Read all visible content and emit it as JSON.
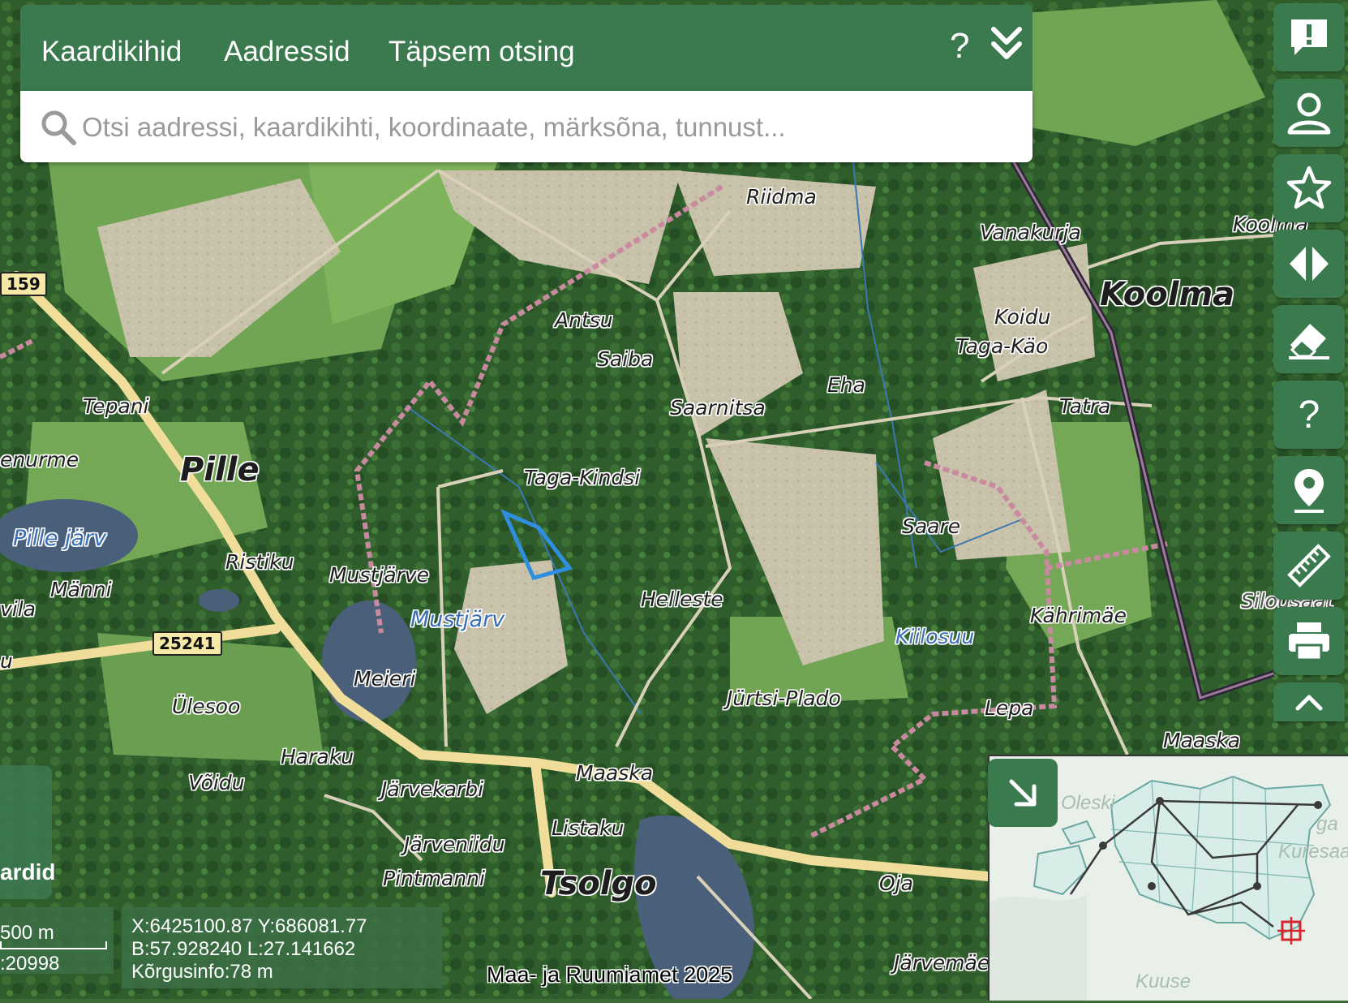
{
  "header": {
    "tabs": [
      {
        "label": "Kaardikihid"
      },
      {
        "label": "Aadressid"
      },
      {
        "label": "Täpsem otsing"
      }
    ],
    "help_label": "?",
    "search_placeholder": "Otsi aadressi, kaardikihti, koordinaate, märksõna, tunnust..."
  },
  "toolbar": {
    "buttons": [
      {
        "icon": "feedback-icon"
      },
      {
        "icon": "user-icon"
      },
      {
        "icon": "star-icon"
      },
      {
        "icon": "compare-icon"
      },
      {
        "icon": "eraser-icon"
      },
      {
        "icon": "help-icon",
        "label": "?"
      },
      {
        "icon": "location-pin-icon"
      },
      {
        "icon": "ruler-icon"
      },
      {
        "icon": "print-icon"
      },
      {
        "icon": "chevron-up-icon"
      }
    ]
  },
  "map": {
    "places": {
      "riidma": "Riidma",
      "vanakurja": "Vanakurja",
      "koolma_small": "Koolma",
      "koolma": "Koolma",
      "koidu": "Koidu",
      "taga_kao": "Taga-Käo",
      "antsu": "Antsu",
      "saiba": "Saiba",
      "eha": "Eha",
      "tatra": "Tatra",
      "saarnitsa": "Saarnitsa",
      "tepani": "Tepani",
      "enurme": "enurme",
      "pille": "Pille",
      "taga_kindsi": "Taga-Kindsi",
      "saare": "Saare",
      "ristiku": "Ristiku",
      "mustjarve": "Mustjärve",
      "manni": "Männi",
      "vila": "vila",
      "helleste": "Helleste",
      "kahrimae": "Kährimäe",
      "silo": "Silousaat",
      "kiilosuu": "Kiilosuu",
      "meieri": "Meieri",
      "ulesoo": "Ülesoo",
      "jurtsi": "Jürtsi-Plado",
      "lepa": "Lepa",
      "maaska_e": "Maaska",
      "haraku": "Haraku",
      "voidu": "Võidu",
      "jarvekarbi": "Järvekarbi",
      "maaska": "Maaska",
      "listaku": "Listaku",
      "jarveniidu": "Järveniidu",
      "pintmanni": "Pintmanni",
      "tsolgo": "Tsolgo",
      "oja": "Oja",
      "jarvemae": "Järvemäe",
      "u": "u"
    },
    "water": {
      "pille_jarv": "Pille järv",
      "mustjarv": "Mustjärv"
    },
    "road_numbers": {
      "r159": "159",
      "r25241": "25241"
    }
  },
  "left_card": {
    "label": "ardid"
  },
  "scale": {
    "distance": "500 m",
    "ratio": ":20998"
  },
  "coordinates": {
    "xy": "X:6425100.87 Y:686081.77",
    "bl": "B:57.928240 L:27.141662",
    "height": "Kõrgusinfo:78 m"
  },
  "attribution": "Maa- ja Ruumiamet 2025",
  "overview": {
    "labels": {
      "oleski": "Oleski",
      "ga": "ga",
      "kuresaa": "Kuresaa",
      "kuuse": "Kuuse"
    }
  },
  "colors": {
    "primary_green": "#3b7a4f",
    "marker_red": "#d8262c",
    "parcel_blue": "#2f8ee0"
  }
}
